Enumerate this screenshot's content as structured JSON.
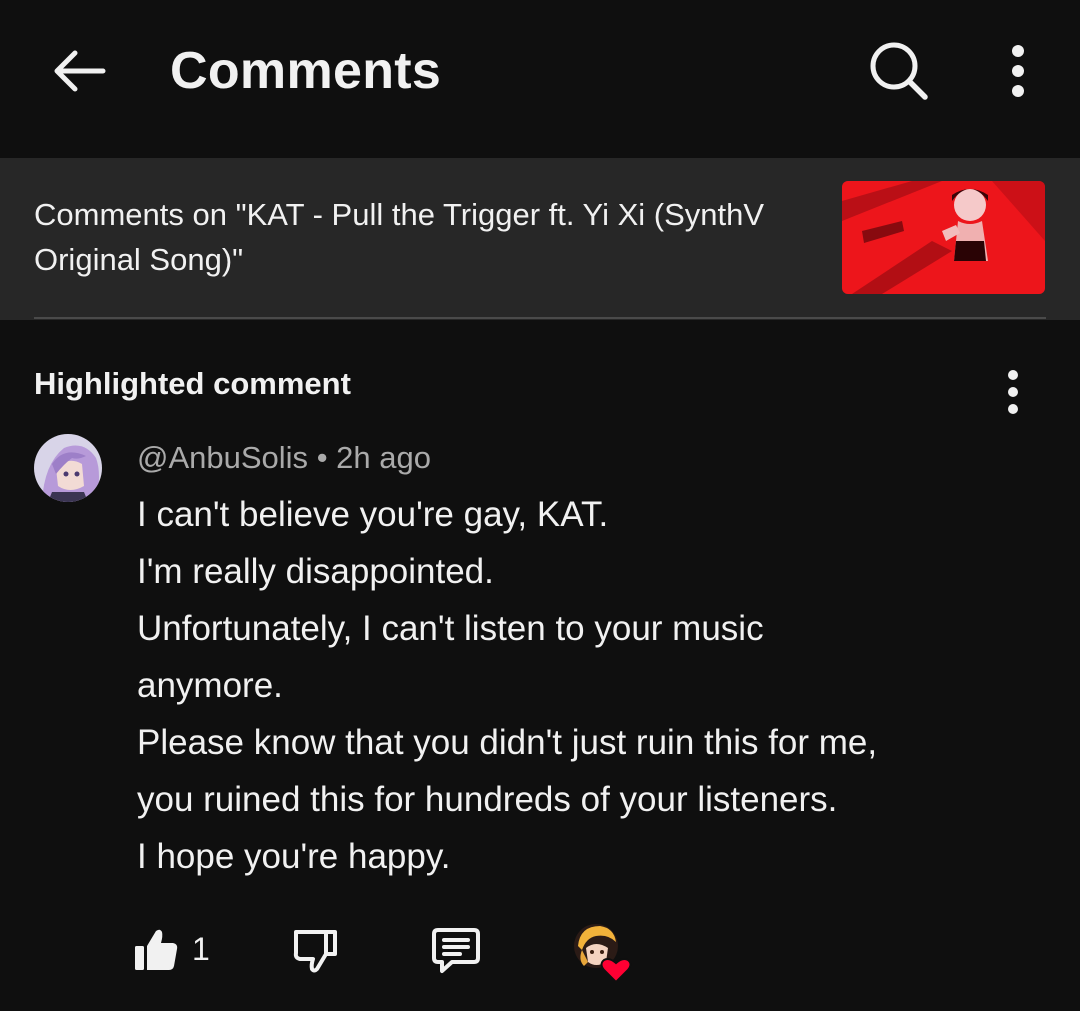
{
  "appbar": {
    "title": "Comments",
    "icons": [
      "back-arrow-icon",
      "search-icon",
      "more-vert-icon"
    ]
  },
  "context": {
    "text": "Comments on \"KAT - Pull the Trigger ft. Yi Xi (SynthV Original Song)\"",
    "thumbnail_accent": "#e4131c"
  },
  "section": {
    "label": "Highlighted comment"
  },
  "comment": {
    "author": "@AnbuSolis",
    "separator": "•",
    "time": "2h ago",
    "lines": [
      "I can't believe you're gay, KAT.",
      "I'm really disappointed.",
      "Unfortunately, I can't listen to your music",
      "anymore.",
      "Please know that you didn't just ruin this for me,",
      "you ruined this for hundreds of your listeners.",
      "I hope you're happy."
    ],
    "likes": "1",
    "action_icons": [
      "thumb-up-icon",
      "thumb-down-icon",
      "reply-icon",
      "creator-heart-icon"
    ]
  },
  "colors": {
    "background": "#0f0f0f",
    "context_background": "#272727",
    "text_primary": "#f1f1f1",
    "text_secondary": "#aaaaaa",
    "heart": "#ff0033"
  }
}
